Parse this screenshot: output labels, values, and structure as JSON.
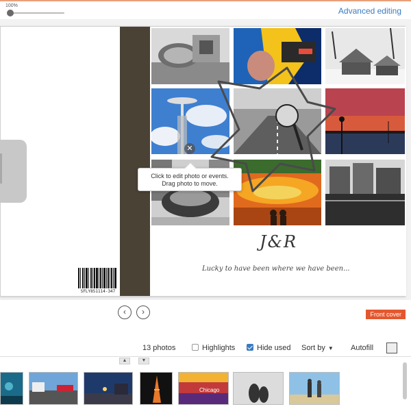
{
  "topbar": {
    "zoom_label": "100%",
    "zoom_level": 1.0,
    "advanced_editing": "Advanced editing"
  },
  "book": {
    "barcode_text": "SFLY851114-347",
    "title": "J&R",
    "subtitle": "Lucky to have been where we have been...",
    "tooltip_line1": "Click to edit photo or events.",
    "tooltip_line2": "Drag photo to move.",
    "close_icon": "✕"
  },
  "nav": {
    "prev_icon": "‹",
    "next_icon": "›",
    "page_label": "Front cover"
  },
  "toolbar": {
    "photo_count": "13 photos",
    "highlights_label": "Highlights",
    "highlights_checked": false,
    "hide_used_label": "Hide used",
    "hide_used_checked": true,
    "sort_label": "Sort by",
    "sort_caret": "▼",
    "autofill_label": "Autofill"
  },
  "filmstrip": {
    "up_icon": "▲",
    "down_icon": "▼",
    "thumb_text": "Chicago"
  },
  "colors": {
    "accent": "#3a7bc0",
    "badge": "#e4572e",
    "spine": "#4b4236"
  }
}
